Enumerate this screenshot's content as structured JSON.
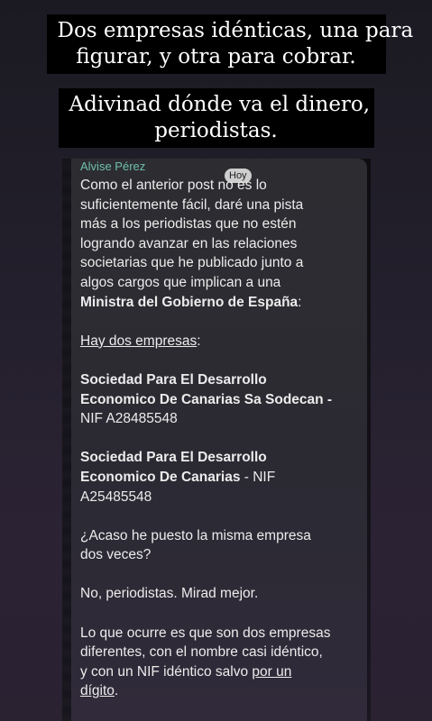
{
  "story": {
    "caption_1": {
      "line1": "Dos empresas idénticas, una para",
      "line2": "figurar, y otra para cobrar."
    },
    "caption_2": {
      "line1": "Adivinad dónde va el dinero,",
      "line2": "periodistas."
    }
  },
  "message": {
    "sender": "Alvise Pérez",
    "date_badge": "Hoy",
    "p1_lines": [
      "Como el anterior post no es lo",
      "suficientemente fácil, daré una pista",
      "más a los periodistas que no estén",
      "logrando avanzar en las relaciones",
      "societarias que he publicado junto a",
      "algos cargos que implican a una"
    ],
    "p1_bold": "Ministra del Gobierno de España",
    "p1_end": ":",
    "hay_label": "Hay dos empresas",
    "hay_end": ":",
    "company1_lines": [
      "Sociedad Para El Desarrollo",
      "Economico De Canarias Sa Sodecan -"
    ],
    "company1_nif": "NIF A28485548",
    "company2_line1": "Sociedad Para El Desarrollo",
    "company2_line2_bold": "Economico De Canarias",
    "company2_line2_rest": " - NIF",
    "company2_nif": "A25485548",
    "question_lines": [
      "¿Acaso he puesto la misma empresa",
      "dos veces?"
    ],
    "answer": "No, periodistas. Mirad mejor.",
    "final_lines": [
      "Lo que ocurre es que son dos empresas",
      "diferentes, con el nombre casi idéntico,"
    ],
    "final_line3_start": "y con un NIF idéntico salvo ",
    "final_line3_underlined": "por un",
    "final_line4_underlined": "dígito",
    "final_line4_end": "."
  },
  "colors": {
    "sender": "#6fbfad",
    "caption_bg": "#000000",
    "text": "#ececec"
  }
}
